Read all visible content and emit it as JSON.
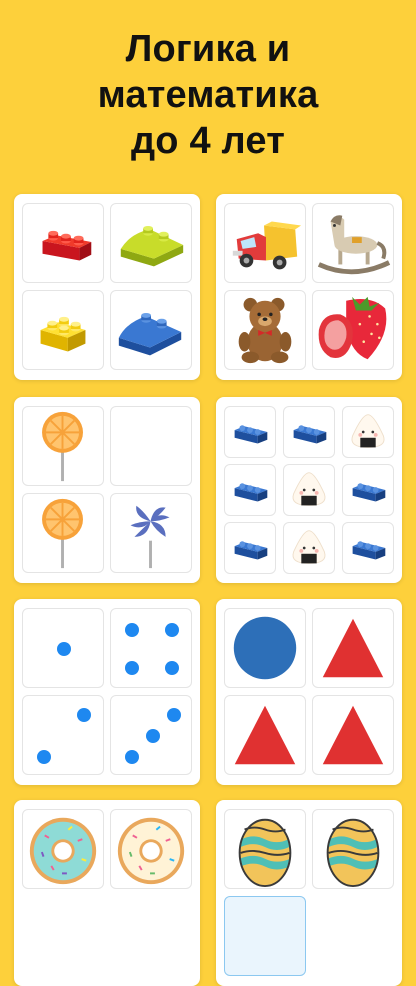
{
  "headline": {
    "line1": "Логика и",
    "line2": "математика",
    "line3": "до 4 лет"
  },
  "colors": {
    "background": "#FDD03B",
    "card": "#FFFFFF",
    "dot_blue": "#1E88F0",
    "circle_blue": "#2D6FB8",
    "triangle_red": "#E03131"
  },
  "cards": [
    {
      "id": "blocks-card",
      "items": [
        "red-brick-icon",
        "green-brick-icon",
        "yellow-brick-icon",
        "blue-brick-icon"
      ]
    },
    {
      "id": "toys-card",
      "items": [
        "toy-truck-icon",
        "rocking-horse-icon",
        "teddy-bear-icon",
        "strawberry-icon"
      ]
    },
    {
      "id": "lollipop-card",
      "items": [
        "orange-lollipop-icon",
        "empty-slot",
        "orange-lollipop-icon",
        "swirl-lollipop-icon"
      ]
    },
    {
      "id": "pattern-card",
      "items": [
        "blue-brick-icon",
        "blue-brick-icon",
        "onigiri-icon",
        "blue-brick-icon",
        "onigiri-icon",
        "blue-brick-icon",
        "blue-brick-icon",
        "onigiri-icon",
        "blue-brick-icon"
      ]
    },
    {
      "id": "counting-dots-card",
      "dot_counts": [
        1,
        4,
        2,
        3
      ]
    },
    {
      "id": "shapes-card",
      "items": [
        "circle-shape",
        "triangle-shape",
        "triangle-shape",
        "triangle-shape"
      ]
    },
    {
      "id": "donuts-card",
      "items": [
        "mint-donut-icon",
        "sprinkle-donut-icon"
      ]
    },
    {
      "id": "eggs-card",
      "items": [
        "easter-egg-icon",
        "easter-egg-icon"
      ]
    }
  ]
}
